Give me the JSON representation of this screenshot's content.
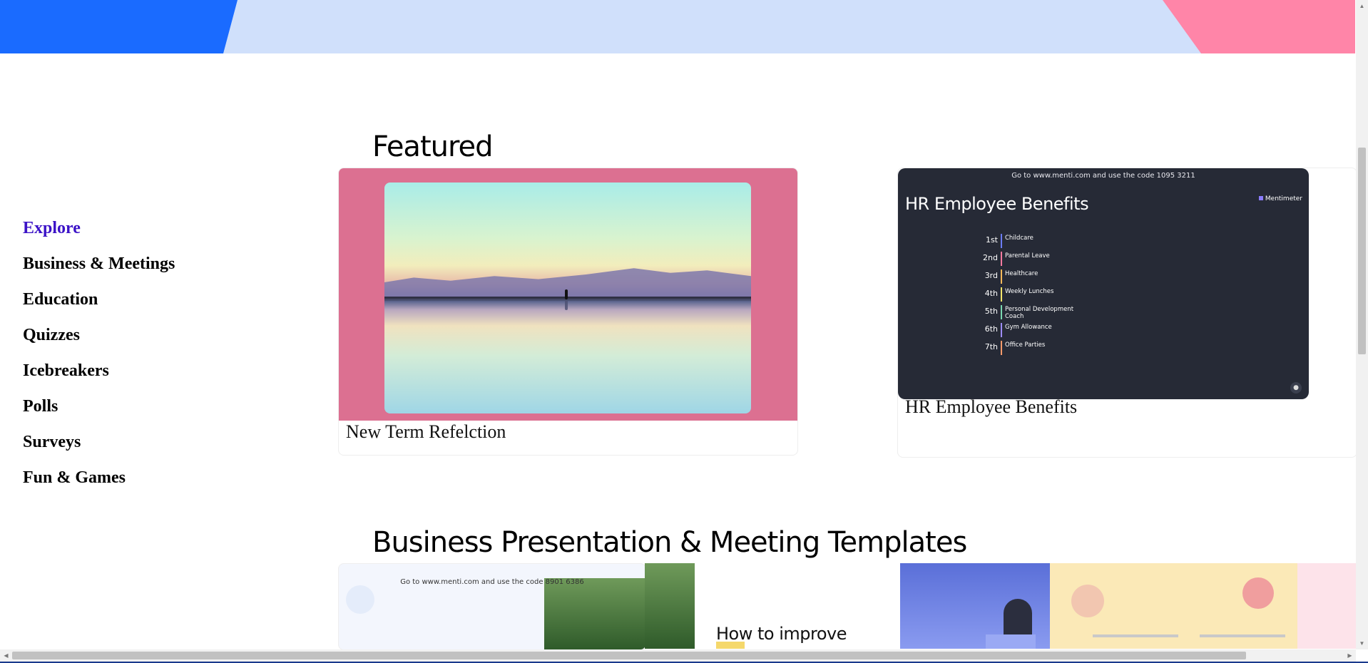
{
  "sidebar": {
    "items": [
      {
        "label": "Explore",
        "active": true
      },
      {
        "label": "Business & Meetings"
      },
      {
        "label": "Education"
      },
      {
        "label": "Quizzes"
      },
      {
        "label": "Icebreakers"
      },
      {
        "label": "Polls"
      },
      {
        "label": "Surveys"
      },
      {
        "label": "Fun & Games"
      }
    ]
  },
  "featured": {
    "title": "Featured",
    "cards": [
      {
        "label": "New Term Refelction"
      },
      {
        "label": "HR Employee Benefits",
        "slide": {
          "top_line": "Go to www.menti.com and use the code 1095 3211",
          "title": "HR Employee Benefits",
          "brand": "Mentimeter",
          "rankings": [
            {
              "rank": "1st",
              "label": "Childcare",
              "color": "#6b7cff"
            },
            {
              "rank": "2nd",
              "label": "Parental Leave",
              "color": "#ff7aa0"
            },
            {
              "rank": "3rd",
              "label": "Healthcare",
              "color": "#ffb95a"
            },
            {
              "rank": "4th",
              "label": "Weekly Lunches",
              "color": "#f5e46b"
            },
            {
              "rank": "5th",
              "label": "Personal Development Coach",
              "color": "#7ad7b0"
            },
            {
              "rank": "6th",
              "label": "Gym Allowance",
              "color": "#9d8cff"
            },
            {
              "rank": "7th",
              "label": "Office Parties",
              "color": "#ff9b6b"
            }
          ]
        }
      }
    ]
  },
  "business": {
    "title": "Business Presentation & Meeting Templates",
    "thumbs": [
      {
        "top_line": "Go to www.menti.com and use the code 8901 6386"
      },
      {
        "heading": "How to improve"
      },
      {},
      {}
    ]
  },
  "colors": {
    "accent": "#3b12c7",
    "banner_blue": "#1a6bff",
    "banner_pink": "#ff85a8",
    "card_pink": "#dc7091",
    "slide_bg": "#262a36"
  }
}
